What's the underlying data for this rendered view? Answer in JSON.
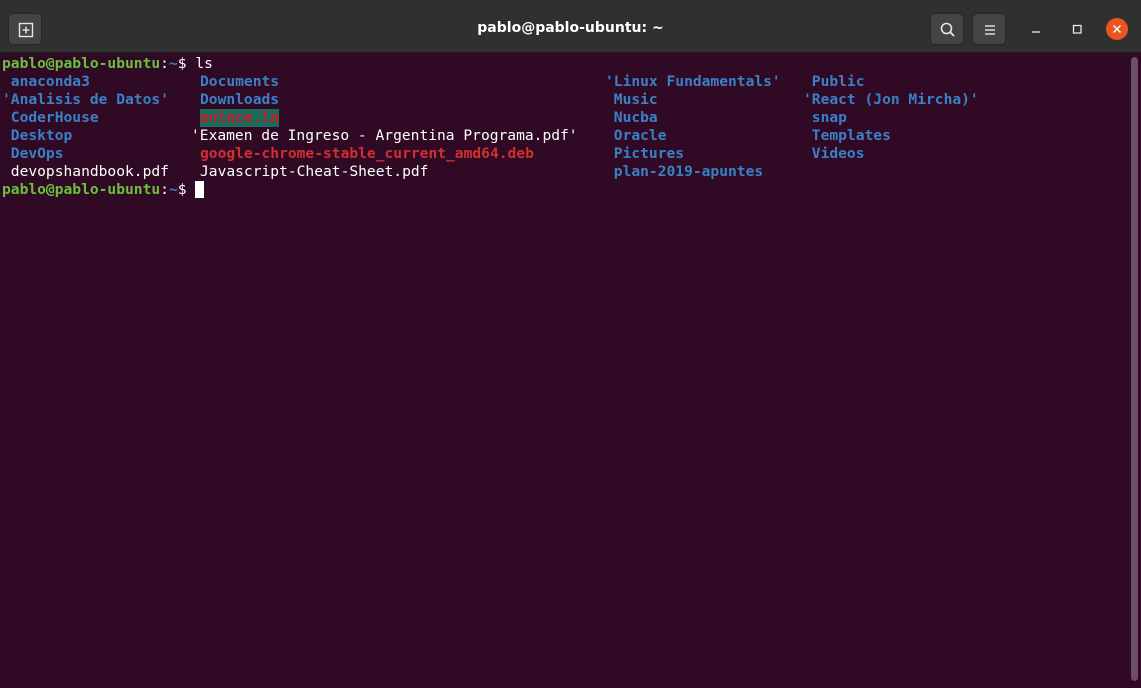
{
  "window": {
    "title": "pablo@pablo-ubuntu: ~"
  },
  "icons": {
    "new_tab": "new-tab-icon",
    "search": "search-icon",
    "menu": "hamburger-menu-icon",
    "minimize": "minimize-icon",
    "maximize": "maximize-icon",
    "close": "close-icon"
  },
  "colors": {
    "background": "#300a24",
    "titlebar": "#303030",
    "directory": "#3b80c7",
    "prompt_user": "#6ac03c",
    "broken_link_fg": "#c01c28",
    "broken_link_bg": "#1d6a5d",
    "package": "#d03030",
    "close_button": "#e95420"
  },
  "terminal": {
    "prompt1": {
      "user": "pablo@pablo-ubuntu",
      "sep": ":",
      "path": "~",
      "dollar": "$ ",
      "command": "ls"
    },
    "listing": {
      "col1": [
        {
          "text": " anaconda3",
          "kind": "dir"
        },
        {
          "text": "'Analisis de Datos'",
          "kind": "dir"
        },
        {
          "text": " CoderHouse",
          "kind": "dir"
        },
        {
          "text": " Desktop",
          "kind": "dir"
        },
        {
          "text": " DevOps",
          "kind": "dir"
        },
        {
          "text": " devopshandbook.pdf",
          "kind": "file"
        }
      ],
      "col2": [
        {
          "text": "Documents",
          "kind": "dir"
        },
        {
          "text": "Downloads",
          "kind": "dir"
        },
        {
          "text": "enlace.ln",
          "kind": "broken-link"
        },
        {
          "text": "'Examen de Ingreso - Argentina Programa.pdf'",
          "kind": "file"
        },
        {
          "text": "google-chrome-stable_current_amd64.deb",
          "kind": "package"
        },
        {
          "text": "Javascript-Cheat-Sheet.pdf",
          "kind": "file"
        }
      ],
      "col3": [
        {
          "text": "'Linux Fundamentals'",
          "kind": "dir"
        },
        {
          "text": " Music",
          "kind": "dir"
        },
        {
          "text": " Nucba",
          "kind": "dir"
        },
        {
          "text": " Oracle",
          "kind": "dir"
        },
        {
          "text": " Pictures",
          "kind": "dir"
        },
        {
          "text": " plan-2019-apuntes",
          "kind": "dir"
        }
      ],
      "col4": [
        {
          "text": " Public",
          "kind": "dir"
        },
        {
          "text": "'React (Jon Mircha)'",
          "kind": "dir"
        },
        {
          "text": " snap",
          "kind": "dir"
        },
        {
          "text": " Templates",
          "kind": "dir"
        },
        {
          "text": " Videos",
          "kind": "dir"
        }
      ]
    },
    "prompt2": {
      "user": "pablo@pablo-ubuntu",
      "sep": ":",
      "path": "~",
      "dollar": "$ "
    }
  }
}
